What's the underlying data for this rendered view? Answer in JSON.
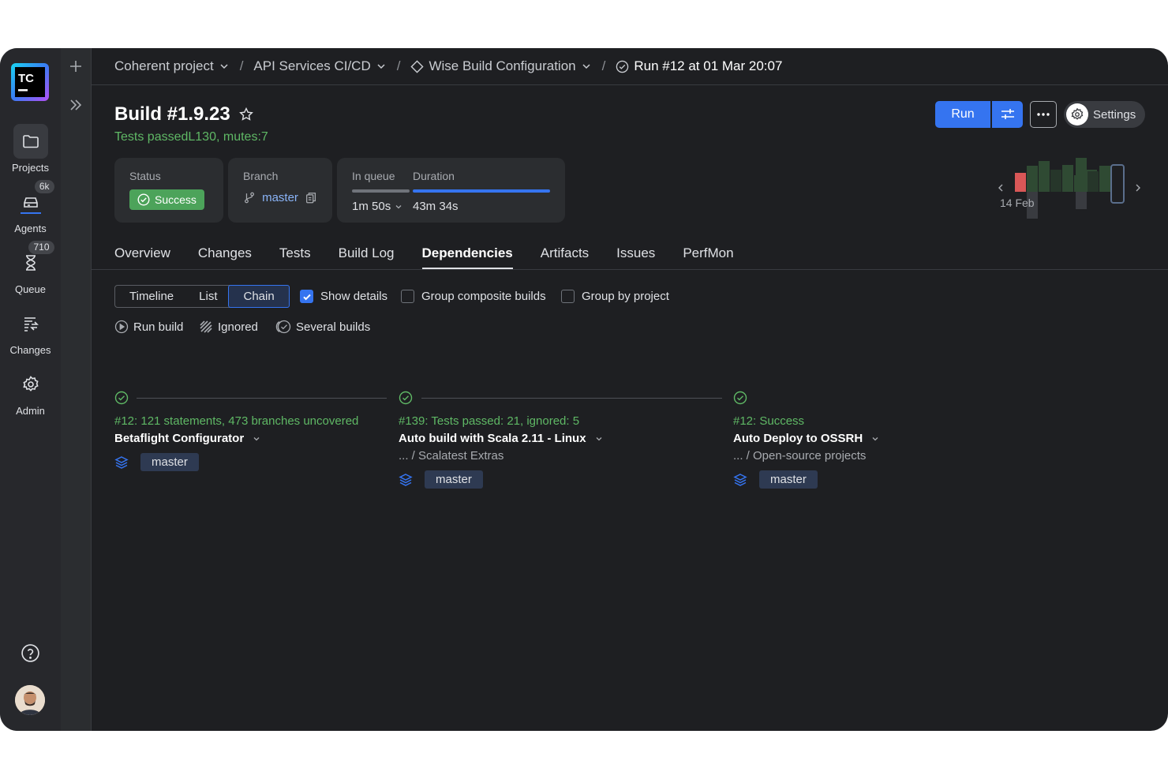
{
  "breadcrumbs": [
    {
      "label": "Coherent project"
    },
    {
      "label": "API Services CI/CD"
    },
    {
      "label": "Wise Build Configuration"
    },
    {
      "label": "Run #12 at 01 Mar 20:07"
    }
  ],
  "rail": {
    "logo_text": "TC",
    "items": [
      {
        "label": "Projects",
        "icon": "folder-icon"
      },
      {
        "label": "Agents",
        "badge": "6k",
        "icon": "agents-icon"
      },
      {
        "label": "Queue",
        "badge": "710",
        "icon": "hourglass-icon"
      },
      {
        "label": "Changes",
        "icon": "changes-icon"
      },
      {
        "label": "Admin",
        "icon": "gear-icon"
      }
    ]
  },
  "build": {
    "title": "Build #1.9.23",
    "subtitle": "Tests passedL130, mutes:7",
    "status_label": "Status",
    "status_value": "Success",
    "branch_label": "Branch",
    "branch_value": "master",
    "queue_label": "In queue",
    "queue_value": "1m 50s",
    "duration_label": "Duration",
    "duration_value": "43m 34s"
  },
  "actions": {
    "run": "Run",
    "settings": "Settings"
  },
  "history": {
    "date": "14 Feb",
    "colors": {
      "failed": "#d95757",
      "ok": "#2f4a33",
      "ok_dark": "#26362a"
    }
  },
  "tabs": [
    "Overview",
    "Changes",
    "Tests",
    "Build Log",
    "Dependencies",
    "Artifacts",
    "Issues",
    "PerfMon"
  ],
  "active_tab": "Dependencies",
  "view": {
    "modes": [
      "Timeline",
      "List",
      "Chain"
    ],
    "active_mode": "Chain",
    "show_details": "Show details",
    "group_composite": "Group composite builds",
    "group_project": "Group by project"
  },
  "legend": {
    "run_build": "Run build",
    "ignored": "Ignored",
    "several": "Several builds"
  },
  "chain": [
    {
      "result": "#12: 121 statements, 473 branches uncovered",
      "name": "Betaflight Configurator",
      "path": "",
      "branch": "master"
    },
    {
      "result": "#139: Tests passed: 21, ignored: 5",
      "name": "Auto build with Scala 2.11 - Linux",
      "path": "... / Scalatest Extras",
      "branch": "master"
    },
    {
      "result": "#12: Success",
      "name": "Auto Deploy to OSSRH",
      "path": "... / Open-source projects",
      "branch": "master"
    }
  ],
  "colors": {
    "accent": "#3574f0",
    "success": "#4ca35a",
    "success_text": "#5fb865",
    "background": "#1e1f22"
  }
}
